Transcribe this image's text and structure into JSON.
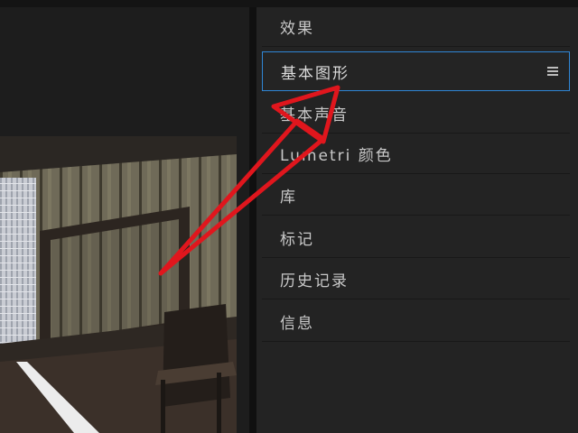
{
  "panel": {
    "items": [
      {
        "label": "效果"
      },
      {
        "label": "基本图形",
        "active": true
      },
      {
        "label": "基本声音"
      },
      {
        "label": "Lumetri 颜色"
      },
      {
        "label": "库"
      },
      {
        "label": "标记"
      },
      {
        "label": "历史记录"
      },
      {
        "label": "信息"
      }
    ],
    "active_border_color": "#2f86d6",
    "menu_icon": "hamburger-menu-icon"
  },
  "annotation": {
    "arrow_color": "#e0161d"
  }
}
